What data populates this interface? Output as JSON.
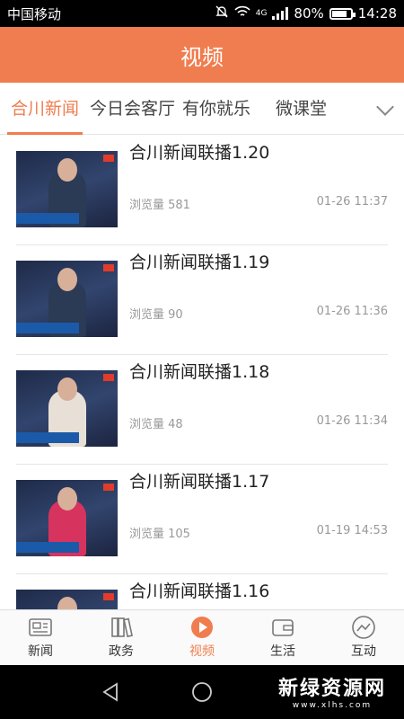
{
  "status": {
    "carrier": "中国移动",
    "network": "4G",
    "battery": "80%",
    "battery_level": 0.8,
    "time": "14:28"
  },
  "header": {
    "title": "视频"
  },
  "tabs": [
    "合川新闻",
    "今日会客厅",
    "有你就乐",
    "微课堂"
  ],
  "items": [
    {
      "title": "合川新闻联播1.20",
      "views": "浏览量 581",
      "time": "01-26 11:37"
    },
    {
      "title": "合川新闻联播1.19",
      "views": "浏览量 90",
      "time": "01-26 11:36"
    },
    {
      "title": "合川新闻联播1.18",
      "views": "浏览量 48",
      "time": "01-26 11:34"
    },
    {
      "title": "合川新闻联播1.17",
      "views": "浏览量 105",
      "time": "01-19 14:53"
    },
    {
      "title": "合川新闻联播1.16",
      "views": "",
      "time": ""
    }
  ],
  "nav": [
    {
      "label": "新闻",
      "icon": "newspaper-icon"
    },
    {
      "label": "政务",
      "icon": "books-icon"
    },
    {
      "label": "视频",
      "icon": "play-icon"
    },
    {
      "label": "生活",
      "icon": "wallet-icon"
    },
    {
      "label": "互动",
      "icon": "interaction-icon"
    }
  ],
  "watermark": {
    "title": "新绿资源网",
    "url": "www.xlhs.com"
  },
  "colors": {
    "accent": "#f07d4f"
  }
}
